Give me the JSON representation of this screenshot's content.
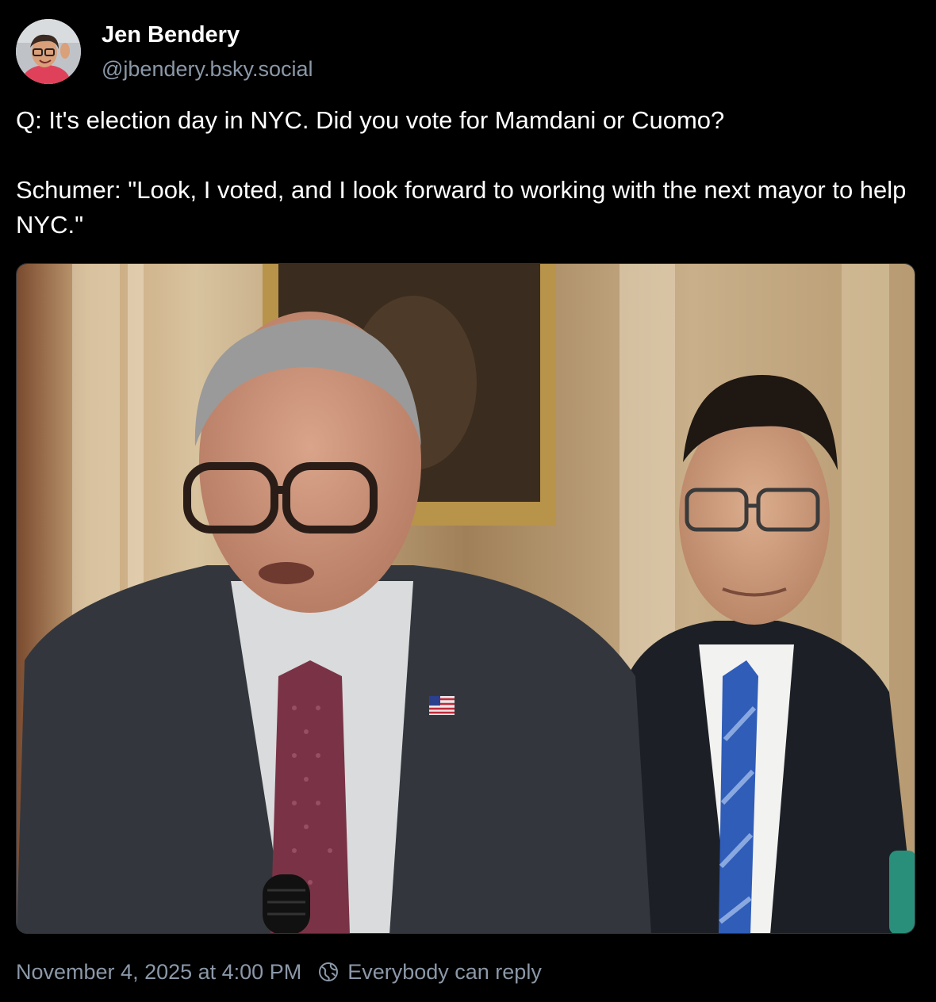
{
  "author": {
    "display_name": "Jen Bendery",
    "handle": "@jbendery.bsky.social"
  },
  "post": {
    "paragraphs": [
      "Q: It's election day in NYC. Did you vote for Mamdani or Cuomo?",
      "Schumer: \"Look, I voted, and I look forward to working with the next mayor to help NYC.\""
    ],
    "media_alt": "Photo: Chuck Schumer speaking at a press conference with another senator standing behind him",
    "timestamp": "November 4, 2025 at 4:00 PM",
    "reply_setting": "Everybody can reply"
  },
  "colors": {
    "background": "#000000",
    "text": "#ffffff",
    "muted": "#8b98a8"
  },
  "icons": {
    "reply_setting": "globe-icon"
  }
}
